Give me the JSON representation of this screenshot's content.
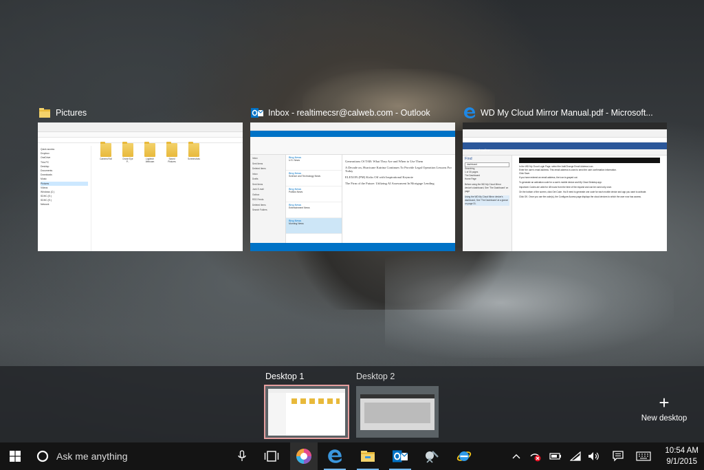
{
  "windows": [
    {
      "title": "Pictures",
      "app": "File Explorer"
    },
    {
      "title": "Inbox - realtimecsr@calweb.com - Outlook",
      "app": "Outlook"
    },
    {
      "title": "WD My Cloud Mirror Manual.pdf - Microsoft...",
      "app": "Microsoft Edge"
    }
  ],
  "explorer": {
    "nav": [
      "Quick access",
      "Dropbox",
      "OneDrive",
      "This PC",
      "Desktop",
      "Documents",
      "Downloads",
      "Music",
      "Pictures",
      "Videos",
      "Windows (C:)",
      "SDHC (E:)",
      "SDHC (E:)",
      "Network"
    ],
    "folders": [
      "Camera Roll",
      "Drone Eye P...",
      "Logitech Webcam",
      "Saved Pictures",
      "Screenshots"
    ]
  },
  "outlook": {
    "folders": [
      "Inbox",
      "Sent Items",
      "Deleted Items",
      "Inbox",
      "Drafts",
      "Sent Items",
      "Junk E-mail",
      "Outbox",
      "RSS Feeds",
      "Deleted Items",
      "Search Folders"
    ],
    "messages": [
      {
        "from": "Bing News",
        "subject": "U.S. News"
      },
      {
        "from": "Bing News",
        "subject": "Science and Technology News"
      },
      {
        "from": "Bing News",
        "subject": "Politics News"
      },
      {
        "from": "Bing News",
        "subject": "Entertainment News"
      },
      {
        "from": "Bing News",
        "subject": "Morning News"
      }
    ],
    "reading": [
      "Generations Of TAB: What They Are and When to Use Them",
      "A Decade on, Hurricane Katrina Continues To Provide Legal Operation Lessons For Today",
      "ELEXON (PM) Kicks Off with Inspirational Keynote",
      "The Firm of the Future: Utilizing AI Assessment In Mortgage Lending"
    ]
  },
  "edge": {
    "app_bar": "Word Online",
    "find_title": "Find",
    "find_items": [
      "dashboard",
      "Searching",
      "1 of 30 pages",
      "The Dashboard",
      "Home Page",
      "Before using the WD My Cloud Mirror device's dashboard, See 'The Dashboard' on page",
      "Using the WD My Cloud Mirror device's dashboard, See 'The Dashboard' at a glance on page 31."
    ],
    "doc_lines": [
      "In the WD My Cloud Login Page, select the Add/Change Email Address icon.",
      "Enter the user's email address. This email address is used to send the user confirmation information.",
      "Click Save.",
      "If you have entered an email address, the icon is grayed out.",
      "To generate an activation code for a user's mobile device and My Cloud Desktop app:",
      "Important: Codes are valid for 48 hours from the time of the request and can be used only once.",
      "On the bottom of the screen, click Get Code. You'll need to generate one code for each mobile device and app you want to activate.",
      "Click OK. Once you use the code(s), the Configure Access page displays the cloud devices to which the user now has access."
    ]
  },
  "desktops": [
    {
      "label": "Desktop 1",
      "active": true
    },
    {
      "label": "Desktop 2",
      "active": false
    }
  ],
  "new_desktop": {
    "symbol": "+",
    "label": "New desktop"
  },
  "taskbar": {
    "search_placeholder": "Ask me anything",
    "apps": [
      "task-view-icon",
      "media-app-icon",
      "edge-icon",
      "file-explorer-icon",
      "outlook-icon",
      "snipping-icon",
      "internet-explorer-icon"
    ],
    "tray": [
      "chevron-up-icon",
      "network-error-icon",
      "battery-icon",
      "wifi-icon",
      "volume-icon",
      "action-center-icon",
      "keyboard-icon"
    ]
  },
  "clock": {
    "time": "10:54 AM",
    "date": "9/1/2015"
  },
  "colors": {
    "accent_desktop": "#e8a0a0",
    "edge_blue": "#1e88e5",
    "outlook_blue": "#0072c6",
    "word_blue": "#2b579a"
  }
}
